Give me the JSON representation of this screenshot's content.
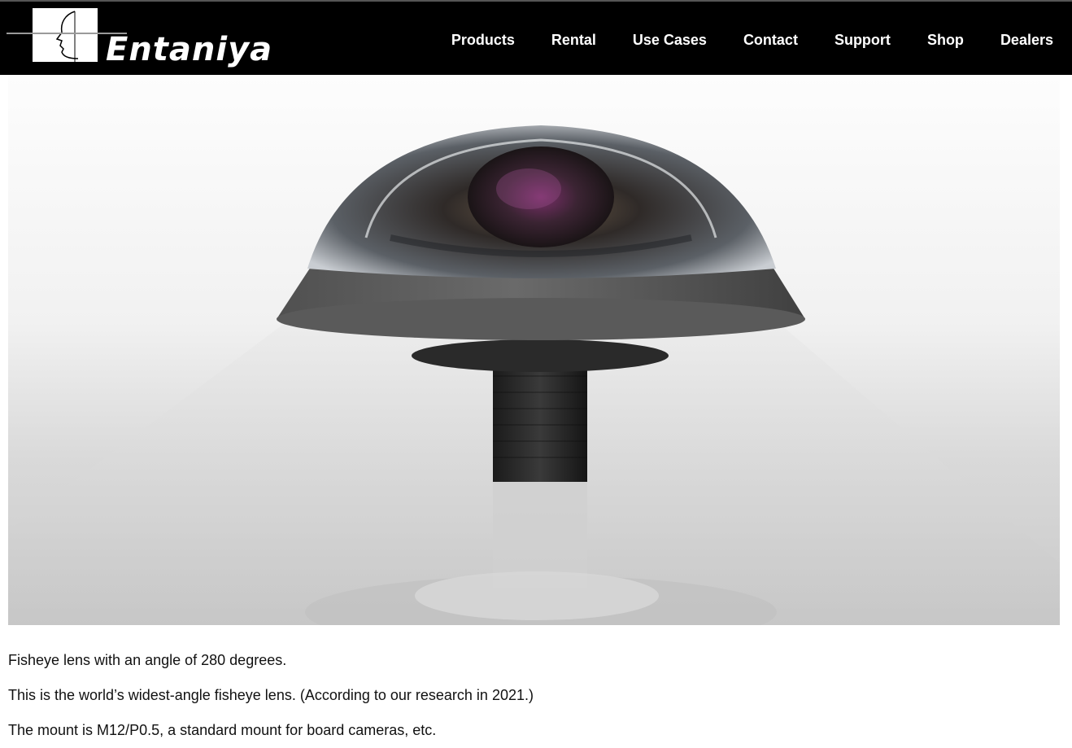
{
  "brand": {
    "name": "Entaniya"
  },
  "nav": {
    "items": [
      "Products",
      "Rental",
      "Use Cases",
      "Contact",
      "Support",
      "Shop",
      "Dealers"
    ]
  },
  "hero": {
    "image": "fisheye-lens-photo"
  },
  "content": {
    "paragraphs": [
      "Fisheye lens with an angle of 280 degrees.",
      "This is the world’s widest-angle fisheye lens. (According to our research in 2021.)",
      "The mount is M12/P0.5, a standard mount for board cameras, etc."
    ]
  },
  "colors": {
    "header_bg": "#000000",
    "nav_text": "#ffffff",
    "body_text": "#111111"
  }
}
